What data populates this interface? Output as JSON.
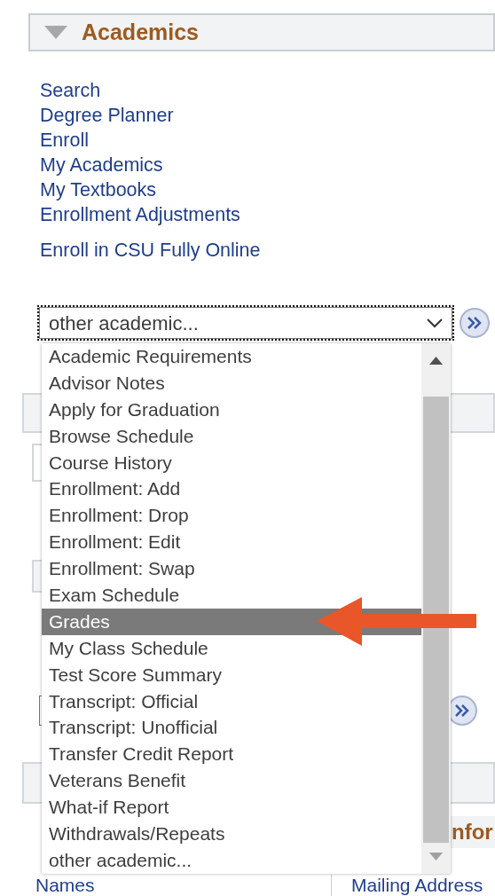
{
  "section": {
    "title": "Academics",
    "expanded": true
  },
  "links": [
    {
      "label": "Search",
      "kind": "main"
    },
    {
      "label": "Degree Planner",
      "kind": "main"
    },
    {
      "label": "Enroll",
      "kind": "main"
    },
    {
      "label": "My Academics",
      "kind": "main"
    },
    {
      "label": "My Textbooks",
      "kind": "main"
    },
    {
      "label": "Enrollment Adjustments",
      "kind": "main"
    },
    {
      "label": "Enroll in CSU Fully Online",
      "kind": "extra"
    }
  ],
  "select": {
    "value": "other academic...",
    "open": true
  },
  "dropdown": {
    "options": [
      {
        "label": "Academic Requirements",
        "selected": false
      },
      {
        "label": "Advisor Notes",
        "selected": false
      },
      {
        "label": "Apply for Graduation",
        "selected": false
      },
      {
        "label": "Browse Schedule",
        "selected": false
      },
      {
        "label": "Course History",
        "selected": false
      },
      {
        "label": "Enrollment: Add",
        "selected": false
      },
      {
        "label": "Enrollment: Drop",
        "selected": false
      },
      {
        "label": "Enrollment: Edit",
        "selected": false
      },
      {
        "label": "Enrollment: Swap",
        "selected": false
      },
      {
        "label": "Exam Schedule",
        "selected": false
      },
      {
        "label": "Grades",
        "selected": true
      },
      {
        "label": "My Class Schedule",
        "selected": false
      },
      {
        "label": "Test Score Summary",
        "selected": false
      },
      {
        "label": "Transcript: Official",
        "selected": false
      },
      {
        "label": "Transcript: Unofficial",
        "selected": false
      },
      {
        "label": "Transfer Credit Report",
        "selected": false
      },
      {
        "label": "Veterans Benefit",
        "selected": false
      },
      {
        "label": "What-if Report",
        "selected": false
      },
      {
        "label": "Withdrawals/Repeats",
        "selected": false
      },
      {
        "label": "other academic...",
        "selected": false
      }
    ]
  },
  "partial_heading": "nfor",
  "bottom_links": [
    "Names",
    "Mailing Address"
  ]
}
